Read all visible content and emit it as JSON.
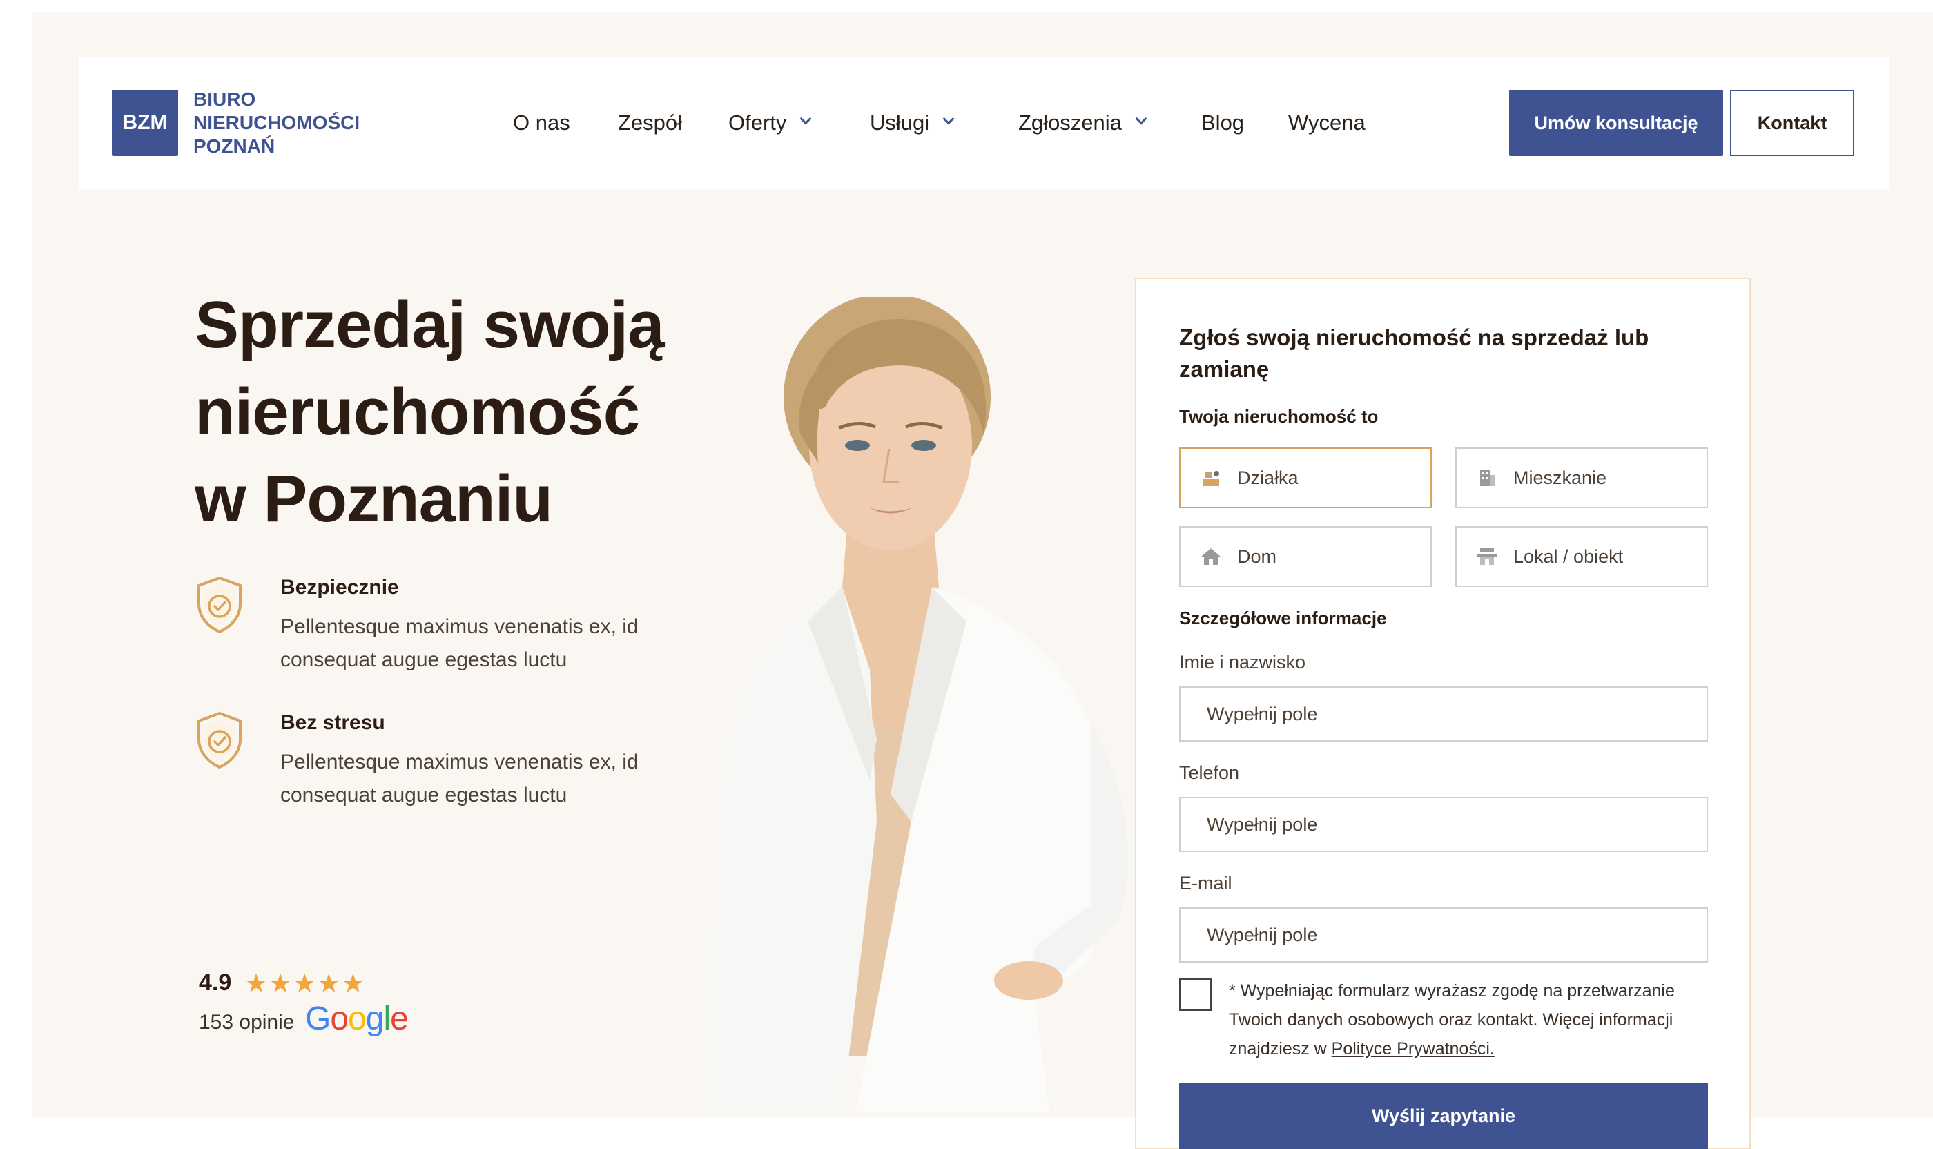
{
  "brand": {
    "logo_mark": "BZM",
    "name_lines": [
      "BIURO",
      "NIERUCHOMOŚCI",
      "POZNAŃ"
    ],
    "primary_color": "#3f5392",
    "accent_color": "#d9a55d"
  },
  "nav": {
    "items": [
      {
        "label": "O nas",
        "has_dropdown": false
      },
      {
        "label": "Zespół",
        "has_dropdown": false
      },
      {
        "label": "Oferty",
        "has_dropdown": true
      },
      {
        "label": "Usługi",
        "has_dropdown": true
      },
      {
        "label": "Zgłoszenia",
        "has_dropdown": true
      },
      {
        "label": "Blog",
        "has_dropdown": false
      },
      {
        "label": "Wycena",
        "has_dropdown": false
      }
    ],
    "cta_primary": "Umów konsultację",
    "cta_secondary": "Kontakt"
  },
  "hero": {
    "title_lines": [
      "Sprzedaj swoją",
      "nieruchomość",
      "w Poznaniu"
    ],
    "features": [
      {
        "icon": "shield-check-icon",
        "title": "Bezpiecznie",
        "desc": "Pellentesque maximus venenatis ex, id consequat augue egestas luctu"
      },
      {
        "icon": "shield-check-icon",
        "title": "Bez stresu",
        "desc": "Pellentesque maximus venenatis ex, id consequat augue egestas luctu"
      }
    ],
    "rating": {
      "score": "4.9",
      "stars": 5,
      "reviews": "153 opinie",
      "provider": "Google"
    }
  },
  "form": {
    "title": "Zgłoś swoją nieruchomość na sprzedaż lub zamianę",
    "property_label": "Twoja nieruchomość to",
    "property_options": [
      {
        "label": "Działka",
        "icon": "plot-icon",
        "selected": true
      },
      {
        "label": "Mieszkanie",
        "icon": "building-icon",
        "selected": false
      },
      {
        "label": "Dom",
        "icon": "house-icon",
        "selected": false
      },
      {
        "label": "Lokal  / obiekt",
        "icon": "shop-icon",
        "selected": false
      }
    ],
    "details_label": "Szczegółowe informacje",
    "fields": [
      {
        "label": "Imie i nazwisko",
        "placeholder": "Wypełnij pole",
        "value": ""
      },
      {
        "label": "Telefon",
        "placeholder": "Wypełnij pole",
        "value": ""
      },
      {
        "label": "E-mail",
        "placeholder": "Wypełnij pole",
        "value": ""
      }
    ],
    "consent_text": "* Wypełniając formularz wyrażasz zgodę na przetwarzanie Twoich danych osobowych oraz kontakt. Więcej informacji znajdziesz w ",
    "consent_link": "Polityce Prywatności.",
    "consent_checked": false,
    "submit_label": "Wyślij zapytanie"
  }
}
